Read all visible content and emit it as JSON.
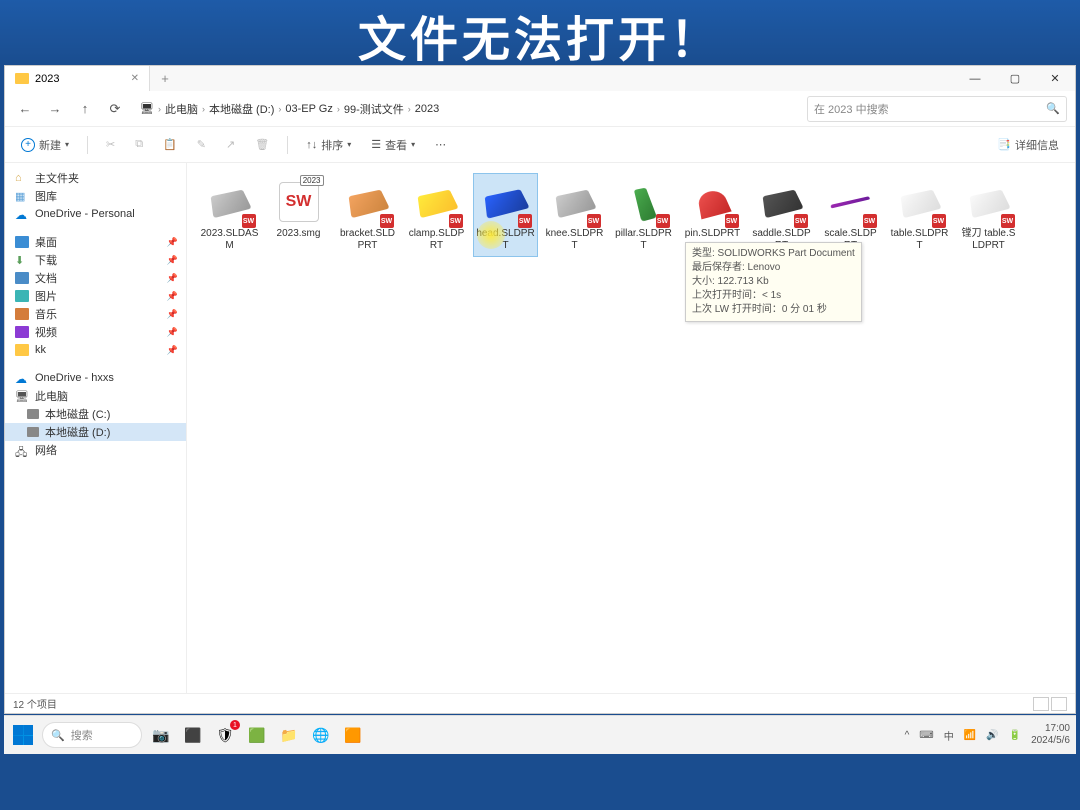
{
  "banner_text": "文件无法打开！",
  "tab": {
    "title": "2023"
  },
  "breadcrumb": [
    "此电脑",
    "本地磁盘 (D:)",
    "03-EP Gz",
    "99-测试文件",
    "2023"
  ],
  "search_placeholder": "在 2023 中搜索",
  "toolbar": {
    "new": "新建",
    "sort": "排序",
    "view": "查看",
    "details": "详细信息"
  },
  "sidebar": {
    "home": "主文件夹",
    "gallery": "图库",
    "onedrive_p": "OneDrive - Personal",
    "desktop": "桌面",
    "downloads": "下载",
    "documents": "文档",
    "pictures": "图片",
    "music": "音乐",
    "videos": "视频",
    "kk": "kk",
    "onedrive_h": "OneDrive - hxxs",
    "thispc": "此电脑",
    "disk_c": "本地磁盘 (C:)",
    "disk_d": "本地磁盘 (D:)",
    "network": "网络"
  },
  "files": [
    {
      "name": "2023.SLDASM"
    },
    {
      "name": "2023.smg"
    },
    {
      "name": "bracket.SLDPRT"
    },
    {
      "name": "clamp.SLDPRT"
    },
    {
      "name": "head.SLDPRT"
    },
    {
      "name": "knee.SLDPRT"
    },
    {
      "name": "pillar.SLDPRT"
    },
    {
      "name": "pin.SLDPRT"
    },
    {
      "name": "saddle.SLDPRT"
    },
    {
      "name": "scale.SLDPRT"
    },
    {
      "name": "table.SLDPRT"
    },
    {
      "name": "镗刀 table.SLDPRT"
    }
  ],
  "tooltip": {
    "l1": "类型: SOLIDWORKS Part Document",
    "l2": "最后保存者: Lenovo",
    "l3": "大小: 122.713 Kb",
    "l4": "上次打开时间：< 1s",
    "l5": "上次 LW 打开时间：0 分 01 秒"
  },
  "status": "12 个项目",
  "taskbar": {
    "search": "搜索"
  },
  "systray": {
    "ime": "中",
    "time": "17:00",
    "date": "2024/5/6"
  }
}
